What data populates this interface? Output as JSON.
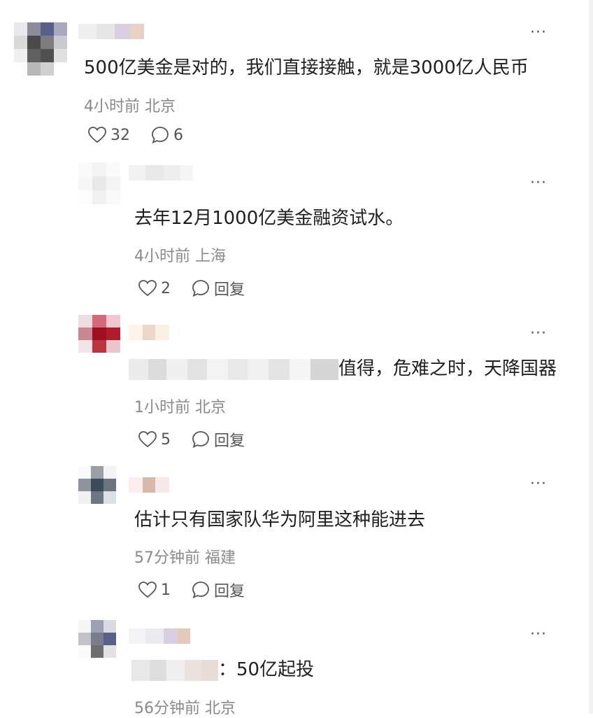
{
  "comments": [
    {
      "text": "500亿美金是对的，我们直接接触，就是3000亿人民币",
      "time": "4小时前",
      "location": "北京",
      "likes": "32",
      "replies": "6",
      "more": "···"
    },
    {
      "text": "去年12月1000亿美金融资试水。",
      "time": "4小时前",
      "location": "上海",
      "likes": "2",
      "reply_label": "回复",
      "more": "···"
    },
    {
      "text": "值得，危难之时，天降国器",
      "time": "1小时前",
      "location": "北京",
      "likes": "5",
      "reply_label": "回复",
      "more": "···"
    },
    {
      "text": "估计只有国家队华为阿里这种能进去",
      "time": "57分钟前",
      "location": "福建",
      "likes": "1",
      "reply_label": "回复",
      "more": "···"
    },
    {
      "text": "：50亿起投",
      "time": "56分钟前",
      "location": "北京",
      "more": "···"
    }
  ]
}
